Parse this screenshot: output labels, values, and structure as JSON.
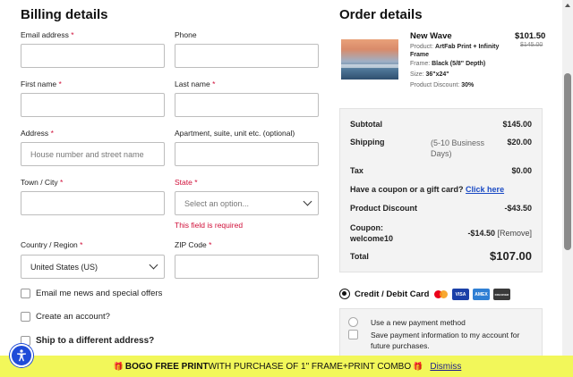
{
  "billing": {
    "title": "Billing details",
    "email": {
      "label": "Email address",
      "value": ""
    },
    "phone": {
      "label": "Phone",
      "value": ""
    },
    "first_name": {
      "label": "First name",
      "value": ""
    },
    "last_name": {
      "label": "Last name",
      "value": ""
    },
    "address": {
      "label": "Address",
      "placeholder": "House number and street name"
    },
    "apartment": {
      "label": "Apartment, suite, unit etc. (optional)",
      "value": ""
    },
    "town": {
      "label": "Town / City",
      "value": ""
    },
    "state": {
      "label": "State",
      "placeholder": "Select an option...",
      "error": "This field is required"
    },
    "country": {
      "label": "Country / Region",
      "value": "United States (US)"
    },
    "zip": {
      "label": "ZIP Code",
      "value": ""
    },
    "required_mark": "*",
    "checkboxes": {
      "email_news": "Email me news and special offers",
      "create_account": "Create an account?",
      "ship_different": "Ship to a different address?"
    }
  },
  "order": {
    "title": "Order details",
    "product": {
      "name": "New Wave",
      "price": "$101.50",
      "old_price": "$145.00",
      "product_label": "Product:",
      "product_value": "ArtFab Print + Infinity Frame",
      "frame_label": "Frame:",
      "frame_value": "Black (5/8\" Depth)",
      "size_label": "Size:",
      "size_value": "36\"x24\"",
      "discount_label": "Product Discount:",
      "discount_value": "30%"
    },
    "summary": {
      "subtotal_label": "Subtotal",
      "subtotal_value": "$145.00",
      "shipping_label": "Shipping",
      "shipping_note": "(5-10 Business Days)",
      "shipping_value": "$20.00",
      "tax_label": "Tax",
      "tax_value": "$0.00",
      "coupon_prompt": "Have a coupon or a gift card?",
      "coupon_link": "Click here",
      "discount_label": "Product Discount",
      "discount_value": "-$43.50",
      "coupon_label": "Coupon:",
      "coupon_code": "welcome10",
      "coupon_value": "-$14.50",
      "coupon_remove": "[Remove]",
      "total_label": "Total",
      "total_value": "$107.00"
    },
    "payment": {
      "method_label": "Credit / Debit Card",
      "visa": "VISA",
      "amex": "AMEX",
      "discover": "DISCOVER",
      "new_method": "Use a new payment method",
      "save_info": "Save payment information to my account for future purchases."
    }
  },
  "banner": {
    "icon": "🎁",
    "strong": "BOGO FREE PRINT",
    "text": " WITH PURCHASE OF 1\" FRAME+PRINT COMBO",
    "dismiss": "Dismiss"
  },
  "colors": {
    "required": "#d0103a",
    "link": "#1b4bc4",
    "banner_bg": "#f2f75a",
    "accessibility_button": "#1f4bd8"
  }
}
